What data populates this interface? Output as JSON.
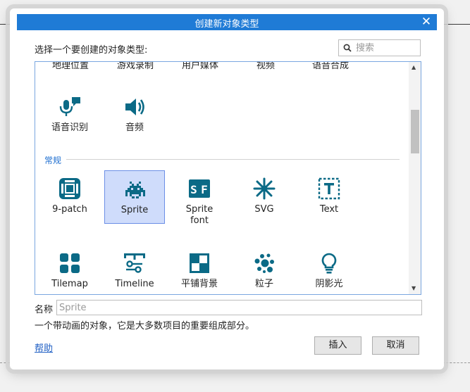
{
  "dialog": {
    "title": "创建新对象类型",
    "prompt": "选择一个要创建的对象类型:",
    "search": {
      "placeholder": "搜索"
    },
    "top_row_labels": [
      "地理位置",
      "游戏录制",
      "用户媒体",
      "视频",
      "语音合成"
    ],
    "media_items": [
      {
        "label": "语音识别",
        "icon": "microphone-speech-icon"
      },
      {
        "label": "音频",
        "icon": "speaker-audio-icon"
      }
    ],
    "section_general": "常规",
    "general_items": [
      {
        "label": "9-patch",
        "icon": "nine-patch-icon"
      },
      {
        "label": "Sprite",
        "icon": "space-invader-sprite-icon",
        "selected": true
      },
      {
        "label": "Sprite\nfont",
        "icon": "sprite-font-icon"
      },
      {
        "label": "SVG",
        "icon": "svg-asterisk-icon"
      },
      {
        "label": "Text",
        "icon": "text-icon"
      },
      {
        "label": "Tilemap",
        "icon": "tilemap-icon"
      },
      {
        "label": "Timeline",
        "icon": "timeline-icon"
      },
      {
        "label": "平铺背景",
        "icon": "tiled-background-icon"
      },
      {
        "label": "粒子",
        "icon": "particles-icon"
      },
      {
        "label": "阴影光",
        "icon": "shadow-light-icon"
      }
    ],
    "name_label": "名称",
    "name_placeholder": "Sprite",
    "description": "一个带动画的对象，它是大多数项目的重要组成部分。",
    "help_link": "帮助",
    "insert_button": "插入",
    "cancel_button": "取消",
    "colors": {
      "title_bar": "#1f7bd6",
      "icon": "#0b6a86",
      "selection": "#cfdcfb"
    }
  }
}
